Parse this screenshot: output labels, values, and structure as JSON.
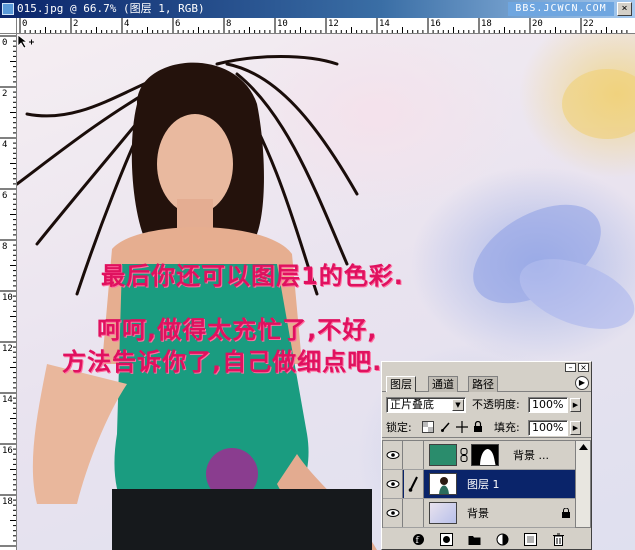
{
  "window": {
    "title": "015.jpg @ 66.7% (图层 1, RGB)",
    "watermark": "BBS.JCWCN.COM",
    "close_label": "×"
  },
  "rulers": {
    "top_labels": [
      "0",
      "2",
      "4",
      "6",
      "8",
      "10",
      "12",
      "14",
      "16",
      "18",
      "20",
      "22"
    ],
    "left_labels": [
      "0",
      "2",
      "4",
      "6",
      "8",
      "10",
      "12",
      "14",
      "16",
      "18"
    ]
  },
  "canvas": {
    "overlay_lines": [
      "最后你还可以图层1的色彩.",
      "呵呵,做得太充忙了,不好,",
      "方法告诉你了,自己做细点吧."
    ],
    "overlay_color": "#e0115f"
  },
  "layers_panel": {
    "tabs": [
      {
        "label": "图层",
        "active": true
      },
      {
        "label": "通道",
        "active": false
      },
      {
        "label": "路径",
        "active": false
      }
    ],
    "blend_mode": "正片叠底",
    "opacity_label": "不透明度:",
    "opacity_value": "100%",
    "lock_label": "锁定:",
    "fill_label": "填充:",
    "fill_value": "100%",
    "layers": [
      {
        "name": "背景 ...",
        "visible": true,
        "selected": false,
        "has_mask": true
      },
      {
        "name": "图层 1",
        "visible": true,
        "selected": true,
        "has_mask": false
      },
      {
        "name": "背景",
        "visible": true,
        "selected": false,
        "has_mask": false,
        "locked": true
      }
    ]
  }
}
